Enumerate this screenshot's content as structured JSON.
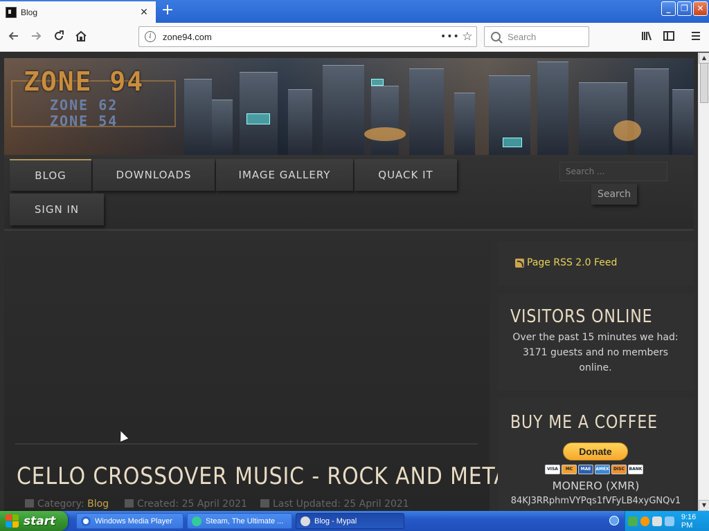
{
  "browser": {
    "tab_title": "Blog",
    "tab_close": "✕",
    "new_tab": "+",
    "url": "zone94.com",
    "search_placeholder": "Search",
    "window_controls": [
      "_",
      "❐",
      "✕"
    ],
    "icons": [
      "back-arrow-icon",
      "forward-arrow-icon",
      "reload-icon",
      "home-icon",
      "site-info-icon",
      "page-actions-icon",
      "bookmark-star-icon",
      "library-icon",
      "sidebar-icon",
      "menu-icon"
    ]
  },
  "site": {
    "logo_main": "ZONE 94",
    "logo_sub1": "ZONE 62",
    "logo_sub2": "ZONE 54",
    "nav": {
      "blog": "BLOG",
      "downloads": "DOWNLOADS",
      "image_gallery": "IMAGE GALLERY",
      "quack_it": "QUACK IT",
      "sign_in": "SIGN IN"
    },
    "search_placeholder": "Search ...",
    "search_button": "Search"
  },
  "article": {
    "title": "CELLO CROSSOVER MUSIC - ROCK AND METAL",
    "category_label": "Category:",
    "category_value": "Blog",
    "created": "Created: 25 April 2021",
    "updated": "Last Updated: 25 April 2021"
  },
  "sidebar": {
    "rss_link": "Page RSS 2.0 Feed",
    "visitors_heading": "VISITORS ONLINE",
    "visitors_text": "Over the past 15 minutes we had: 3171 guests and no members online.",
    "coffee_heading": "BUY ME A COFFEE",
    "donate_label": "Donate",
    "cards": [
      "VISA",
      "MC",
      "MAE",
      "AMEX",
      "DISC",
      "BANK"
    ],
    "coin_name": "MONERO (XMR)",
    "coin_address": "84KJ3RRphmVYPqs1fVFyLB4xyGNQv1"
  },
  "taskbar": {
    "start_label": "start",
    "items": [
      {
        "label": "Windows Media Player",
        "active": false
      },
      {
        "label": "Steam, The Ultimate ...",
        "active": false
      },
      {
        "label": "Blog - Mypal",
        "active": true
      }
    ],
    "clock": "9:16 PM"
  }
}
